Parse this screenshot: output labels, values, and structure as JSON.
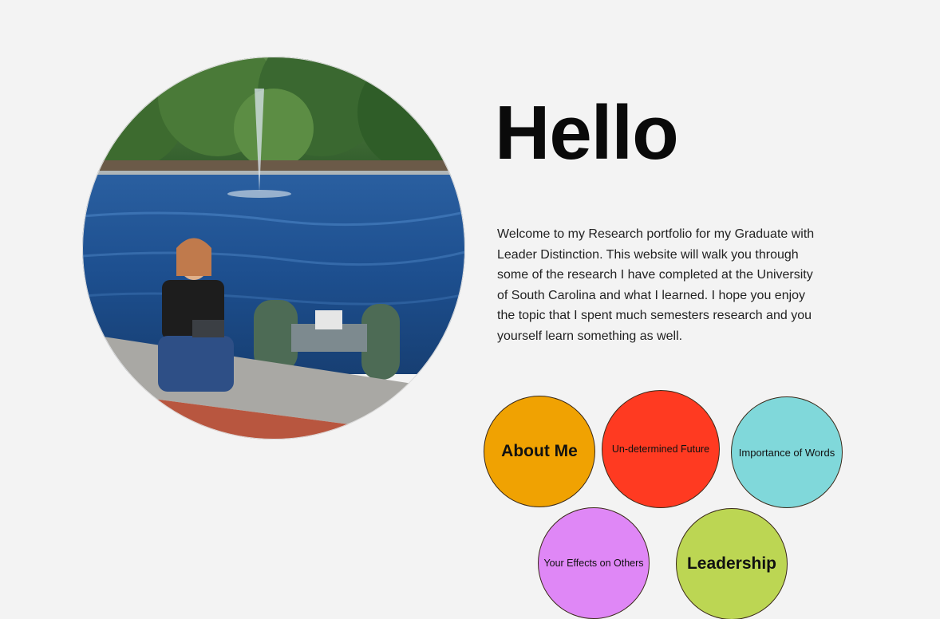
{
  "hero": {
    "heading": "Hello",
    "intro": "Welcome to my Research portfolio for my Graduate with Leader Distinction. This website will walk you through some of the research I have completed at the University of South Carolina and what I learned. I hope you enjoy the topic that I spent much semesters research and you yourself learn something as well."
  },
  "photo": {
    "subject": "person-kneeling-by-pond-with-floating-robot"
  },
  "nav": {
    "about_me": "About Me",
    "undetermined_future": "Un-determined Future",
    "importance_of_words": "Importance of Words",
    "your_effects_on_others": "Your Effects on Others",
    "leadership": "Leadership"
  },
  "colors": {
    "background": "#f3f3f3",
    "about_me": "#f0a202",
    "undetermined_future": "#ff3a21",
    "importance_of_words": "#80d8da",
    "your_effects_on_others": "#df87f6",
    "leadership": "#bcd653"
  }
}
